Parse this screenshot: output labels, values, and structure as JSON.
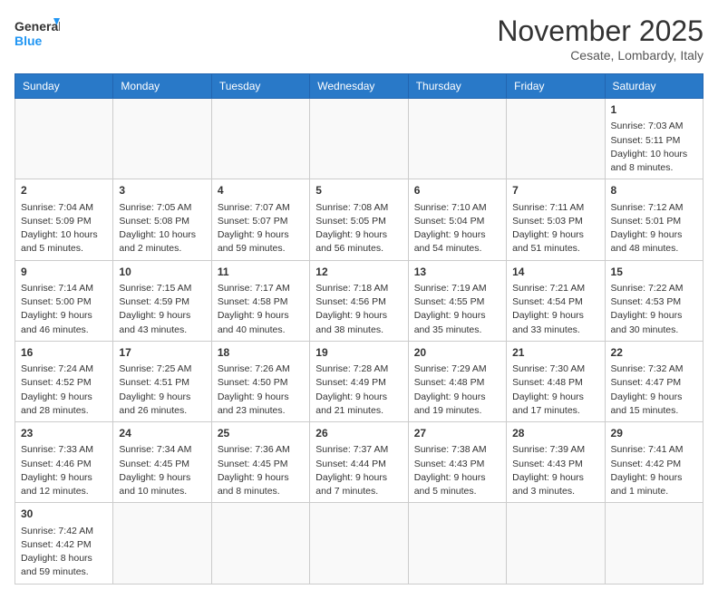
{
  "header": {
    "logo_general": "General",
    "logo_blue": "Blue",
    "month_title": "November 2025",
    "location": "Cesate, Lombardy, Italy"
  },
  "days_of_week": [
    "Sunday",
    "Monday",
    "Tuesday",
    "Wednesday",
    "Thursday",
    "Friday",
    "Saturday"
  ],
  "weeks": [
    [
      {
        "day": "",
        "info": ""
      },
      {
        "day": "",
        "info": ""
      },
      {
        "day": "",
        "info": ""
      },
      {
        "day": "",
        "info": ""
      },
      {
        "day": "",
        "info": ""
      },
      {
        "day": "",
        "info": ""
      },
      {
        "day": "1",
        "info": "Sunrise: 7:03 AM\nSunset: 5:11 PM\nDaylight: 10 hours and 8 minutes."
      }
    ],
    [
      {
        "day": "2",
        "info": "Sunrise: 7:04 AM\nSunset: 5:09 PM\nDaylight: 10 hours and 5 minutes."
      },
      {
        "day": "3",
        "info": "Sunrise: 7:05 AM\nSunset: 5:08 PM\nDaylight: 10 hours and 2 minutes."
      },
      {
        "day": "4",
        "info": "Sunrise: 7:07 AM\nSunset: 5:07 PM\nDaylight: 9 hours and 59 minutes."
      },
      {
        "day": "5",
        "info": "Sunrise: 7:08 AM\nSunset: 5:05 PM\nDaylight: 9 hours and 56 minutes."
      },
      {
        "day": "6",
        "info": "Sunrise: 7:10 AM\nSunset: 5:04 PM\nDaylight: 9 hours and 54 minutes."
      },
      {
        "day": "7",
        "info": "Sunrise: 7:11 AM\nSunset: 5:03 PM\nDaylight: 9 hours and 51 minutes."
      },
      {
        "day": "8",
        "info": "Sunrise: 7:12 AM\nSunset: 5:01 PM\nDaylight: 9 hours and 48 minutes."
      }
    ],
    [
      {
        "day": "9",
        "info": "Sunrise: 7:14 AM\nSunset: 5:00 PM\nDaylight: 9 hours and 46 minutes."
      },
      {
        "day": "10",
        "info": "Sunrise: 7:15 AM\nSunset: 4:59 PM\nDaylight: 9 hours and 43 minutes."
      },
      {
        "day": "11",
        "info": "Sunrise: 7:17 AM\nSunset: 4:58 PM\nDaylight: 9 hours and 40 minutes."
      },
      {
        "day": "12",
        "info": "Sunrise: 7:18 AM\nSunset: 4:56 PM\nDaylight: 9 hours and 38 minutes."
      },
      {
        "day": "13",
        "info": "Sunrise: 7:19 AM\nSunset: 4:55 PM\nDaylight: 9 hours and 35 minutes."
      },
      {
        "day": "14",
        "info": "Sunrise: 7:21 AM\nSunset: 4:54 PM\nDaylight: 9 hours and 33 minutes."
      },
      {
        "day": "15",
        "info": "Sunrise: 7:22 AM\nSunset: 4:53 PM\nDaylight: 9 hours and 30 minutes."
      }
    ],
    [
      {
        "day": "16",
        "info": "Sunrise: 7:24 AM\nSunset: 4:52 PM\nDaylight: 9 hours and 28 minutes."
      },
      {
        "day": "17",
        "info": "Sunrise: 7:25 AM\nSunset: 4:51 PM\nDaylight: 9 hours and 26 minutes."
      },
      {
        "day": "18",
        "info": "Sunrise: 7:26 AM\nSunset: 4:50 PM\nDaylight: 9 hours and 23 minutes."
      },
      {
        "day": "19",
        "info": "Sunrise: 7:28 AM\nSunset: 4:49 PM\nDaylight: 9 hours and 21 minutes."
      },
      {
        "day": "20",
        "info": "Sunrise: 7:29 AM\nSunset: 4:48 PM\nDaylight: 9 hours and 19 minutes."
      },
      {
        "day": "21",
        "info": "Sunrise: 7:30 AM\nSunset: 4:48 PM\nDaylight: 9 hours and 17 minutes."
      },
      {
        "day": "22",
        "info": "Sunrise: 7:32 AM\nSunset: 4:47 PM\nDaylight: 9 hours and 15 minutes."
      }
    ],
    [
      {
        "day": "23",
        "info": "Sunrise: 7:33 AM\nSunset: 4:46 PM\nDaylight: 9 hours and 12 minutes."
      },
      {
        "day": "24",
        "info": "Sunrise: 7:34 AM\nSunset: 4:45 PM\nDaylight: 9 hours and 10 minutes."
      },
      {
        "day": "25",
        "info": "Sunrise: 7:36 AM\nSunset: 4:45 PM\nDaylight: 9 hours and 8 minutes."
      },
      {
        "day": "26",
        "info": "Sunrise: 7:37 AM\nSunset: 4:44 PM\nDaylight: 9 hours and 7 minutes."
      },
      {
        "day": "27",
        "info": "Sunrise: 7:38 AM\nSunset: 4:43 PM\nDaylight: 9 hours and 5 minutes."
      },
      {
        "day": "28",
        "info": "Sunrise: 7:39 AM\nSunset: 4:43 PM\nDaylight: 9 hours and 3 minutes."
      },
      {
        "day": "29",
        "info": "Sunrise: 7:41 AM\nSunset: 4:42 PM\nDaylight: 9 hours and 1 minute."
      }
    ],
    [
      {
        "day": "30",
        "info": "Sunrise: 7:42 AM\nSunset: 4:42 PM\nDaylight: 8 hours and 59 minutes."
      },
      {
        "day": "",
        "info": ""
      },
      {
        "day": "",
        "info": ""
      },
      {
        "day": "",
        "info": ""
      },
      {
        "day": "",
        "info": ""
      },
      {
        "day": "",
        "info": ""
      },
      {
        "day": "",
        "info": ""
      }
    ]
  ]
}
